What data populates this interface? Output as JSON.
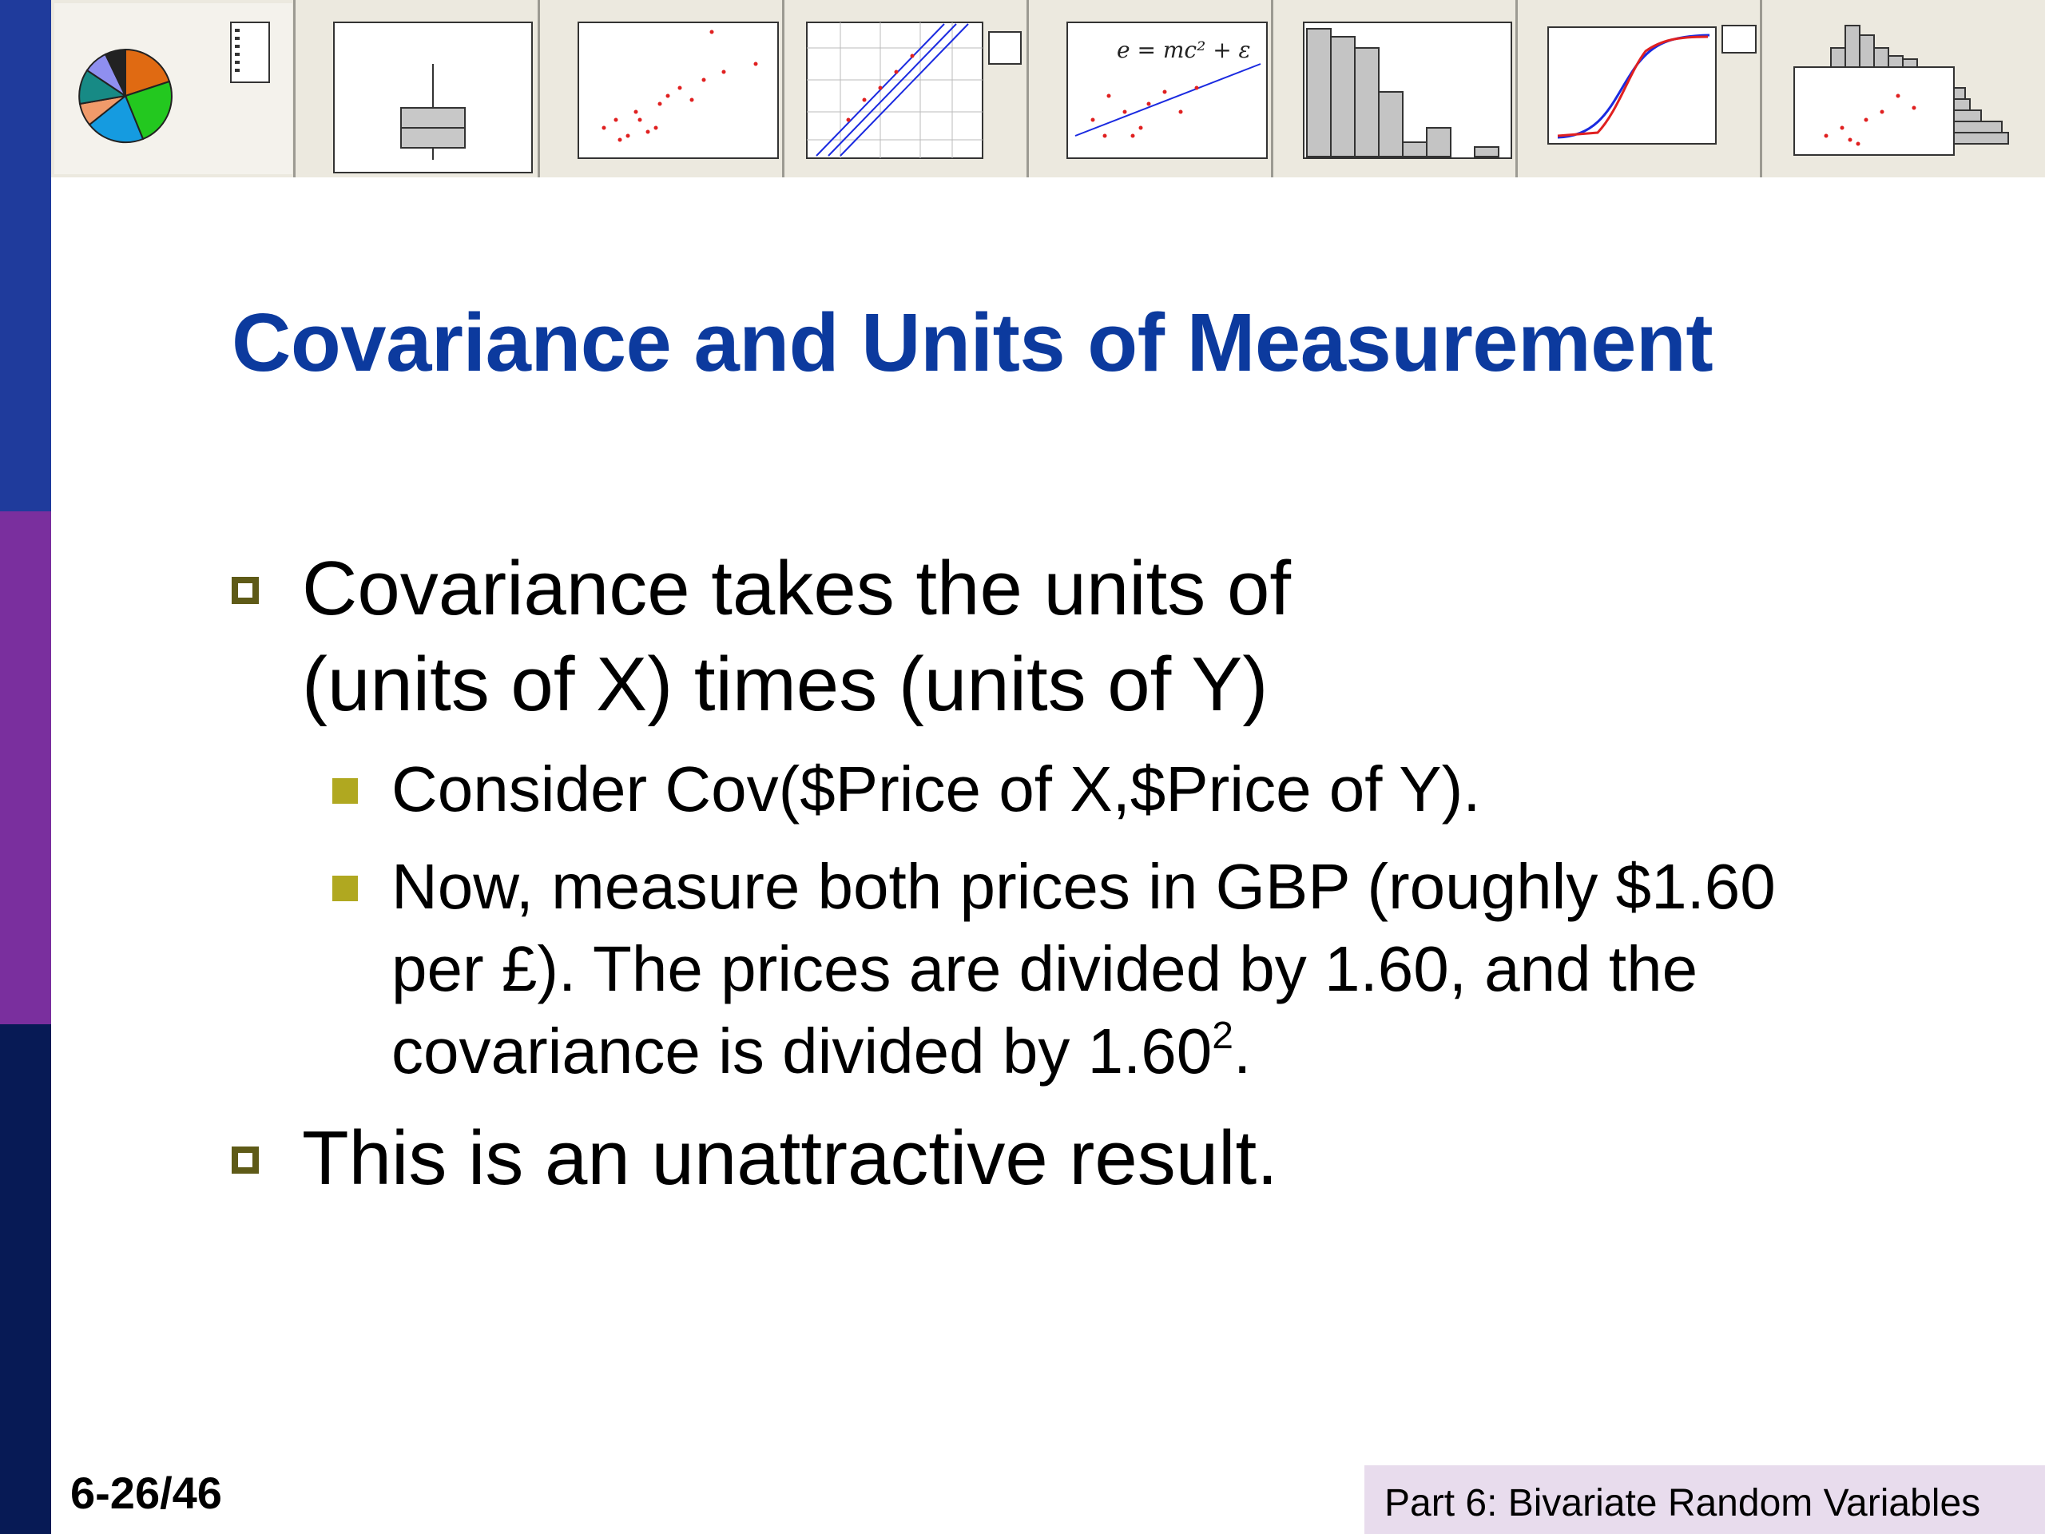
{
  "slide": {
    "title": "Covariance and Units of Measurement",
    "bullets": {
      "b1_line1": "Covariance takes the units of",
      "b1_line2": "(units of X) times (units of Y)",
      "sub1": "Consider Cov($Price of X,$Price of Y).",
      "sub2_line1": "Now, measure both prices in GBP (roughly $1.60",
      "sub2_line2": "per £).  The prices are divided by 1.60, and the",
      "sub2_line3_pre": "covariance is divided by 1.60",
      "sub2_line3_sup": "2",
      "sub2_line3_post": ".",
      "b2": "This is an unattractive result."
    },
    "footer_page": "6-26/46",
    "footer_part": "Part 6: Bivariate Random Variables"
  },
  "thumbnails": {
    "formula": "e = mc² + ε"
  },
  "colors": {
    "title": "#0c3a9e",
    "left_bar_top": "#1f3b9c",
    "left_bar_mid": "#7a2f9e",
    "left_bar_bottom": "#071a55",
    "bullet_box": "#5e5a17",
    "sub_bullet": "#b0a820",
    "footer_bg": "#e8dced"
  }
}
